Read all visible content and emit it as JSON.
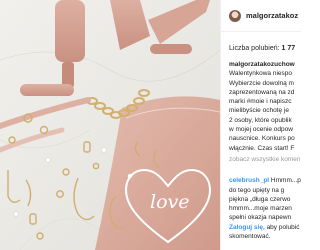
{
  "post": {
    "username": "malgorzatakoz",
    "likes_label": "Liczba polubień:",
    "likes_count": "1 77"
  },
  "photo": {
    "overlay_text": "love"
  },
  "comments": [
    {
      "username": "malgorzatakozuchow",
      "lines": [
        "Walentynkowa niespo",
        "Wybierzcie dowolną m",
        "zaprezentowaną na zd",
        "marki #moie i napiszc",
        "mielibyście ochotę je",
        "2 osoby, które opublik",
        "w mojej ocenie odpow",
        "nauscnice. Konkurs po",
        "włącznie. Czas start! F"
      ]
    },
    {
      "username": "celebrush_pl",
      "lines": [
        "Hmmm...p",
        "do tego upięty na g",
        "piękna „długa czerwo",
        "hmmm...moje marzen",
        "spełni okazja napewn"
      ]
    }
  ],
  "see_all_label": "zobacz wszystkie komen",
  "login": {
    "link": "Zaloguj się",
    "suffix": ", aby polubić",
    "line2": "skomentować."
  },
  "colors": {
    "link": "#3897f0",
    "muted": "#999999",
    "text": "#262626",
    "blush": "#e0b3a6",
    "gold": "#d4b06a"
  }
}
